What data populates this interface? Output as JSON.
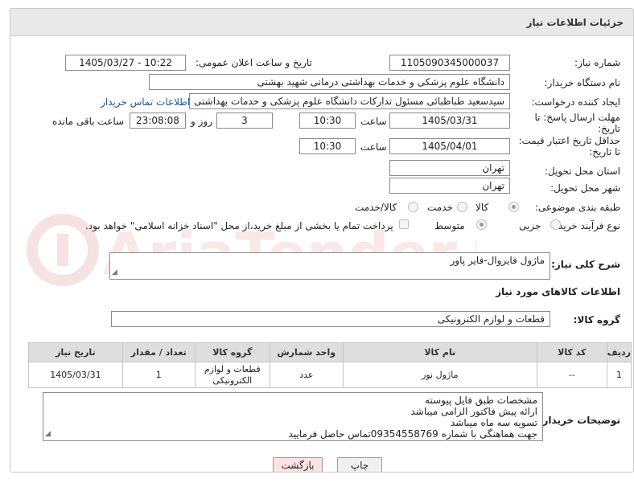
{
  "header": {
    "title": "جزئیات اطلاعات نیاز"
  },
  "need_number": {
    "label": "شماره نیاز:",
    "value": "1105090345000037"
  },
  "announce_datetime": {
    "label": "تاریخ و ساعت اعلان عمومی:",
    "value": "1405/03/27 - 10:22"
  },
  "buyer_org": {
    "label": "نام دستگاه خریدار:",
    "value": "دانشگاه علوم پزشکی و خدمات بهداشتی درمانی شهید بهشتی"
  },
  "requester": {
    "label": "ایجاد کننده درخواست:",
    "value": "سیدسعید طباطبائی مسئول تدارکات دانشگاه علوم پزشکی و خدمات بهداشتی",
    "contact_link": "اطلاعات تماس خریدار"
  },
  "response_deadline": {
    "label_line1": "مهلت ارسال پاسخ: تا",
    "label_line2": "تاریخ:",
    "date": "1405/03/31",
    "time_label": "ساعت",
    "time": "10:30",
    "days": "3",
    "days_label": "روز و",
    "remaining": "23:08:08",
    "remaining_label": "ساعت باقی مانده"
  },
  "price_validity": {
    "label_line1": "حداقل تاریخ اعتبار قیمت:",
    "label_line2": "تا تاریخ:",
    "date": "1405/04/01",
    "time_label": "ساعت",
    "time": "10:30"
  },
  "delivery_province": {
    "label": "استان محل تحویل:",
    "value": "تهران"
  },
  "delivery_city": {
    "label": "شهر محل تحویل:",
    "value": "تهران"
  },
  "category": {
    "label": "طبقه بندی موضوعی:",
    "options": [
      "کالا",
      "خدمت",
      "کالا/خدمت"
    ],
    "selected": "کالا"
  },
  "purchase_type": {
    "label": "نوع فرآیند خرید :",
    "options": [
      "جزیی",
      "متوسط"
    ],
    "selected": "متوسط",
    "payment_note": "پرداخت تمام یا بخشی از مبلغ خرید،از محل \"اسناد خزانه اسلامی\" خواهد بود."
  },
  "description": {
    "label": "شرح کلی نیاز:",
    "value": "ماژول فایروال-فایر پاور"
  },
  "goods_info": {
    "title": "اطلاعات کالاهای مورد نیاز"
  },
  "goods_group": {
    "label": "گروه کالا:",
    "value": "قطعات و لوازم الکترونیکی"
  },
  "table": {
    "headers": [
      "ردیف",
      "کد کالا",
      "نام کالا",
      "واحد شمارش",
      "گروه کالا",
      "تعداد / مقدار",
      "تاریخ نیاز"
    ],
    "rows": [
      {
        "row": "1",
        "code": "--",
        "name": "ماژول نور",
        "unit": "عدد",
        "group_line1": "قطعات و لوازم",
        "group_line2": "الکترونیکی",
        "qty": "1",
        "date": "1405/03/31"
      }
    ]
  },
  "buyer_notes": {
    "label": "توضیحات خریدار:",
    "lines": [
      "مشخصات طبق فایل پیوسته",
      "ارائه پیش فاکتور الزامی میباشد",
      "تسویه سه ماه میباشد",
      "جهت هماهنگی با شماره 09354558769تماس حاصل فرمایید"
    ]
  },
  "buttons": {
    "print": "چاپ",
    "back": "بازگشت"
  },
  "watermark": {
    "text": "AriaTender.neT"
  },
  "colors": {
    "header_bg": "#e9e9e9",
    "link": "#1a55a8",
    "watermark": "#f3dada",
    "back_button_bg": "#fbe3e3"
  }
}
